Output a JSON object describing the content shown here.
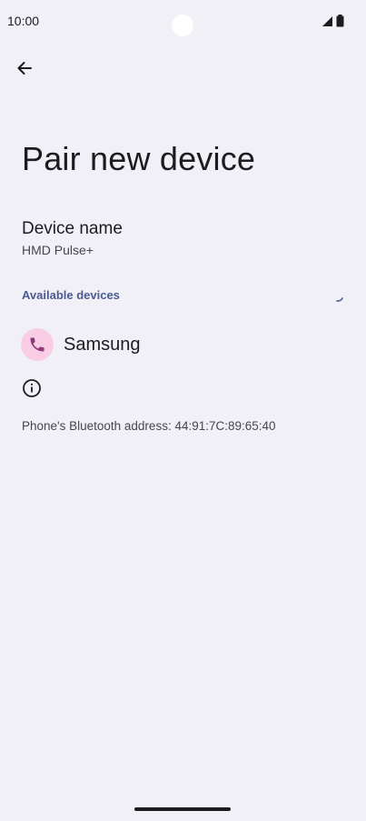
{
  "status_bar": {
    "time": "10:00",
    "icons": [
      "signal-icon",
      "battery-icon"
    ]
  },
  "toolbar": {
    "back_icon": "arrow-back-icon"
  },
  "page": {
    "title": "Pair new device"
  },
  "device_name": {
    "title": "Device name",
    "value": "HMD Pulse+"
  },
  "available_devices": {
    "header": "Available devices",
    "items": [
      {
        "label": "Samsung",
        "icon": "phone-icon"
      }
    ]
  },
  "info": {
    "icon": "info-icon",
    "bluetooth_address": "Phone's Bluetooth address: 44:91:7C:89:65:40"
  },
  "colors": {
    "background": "#f1f0f7",
    "accent": "#4a5a92",
    "avatar_bg": "#f9cde6",
    "avatar_icon": "#8f3a76"
  }
}
